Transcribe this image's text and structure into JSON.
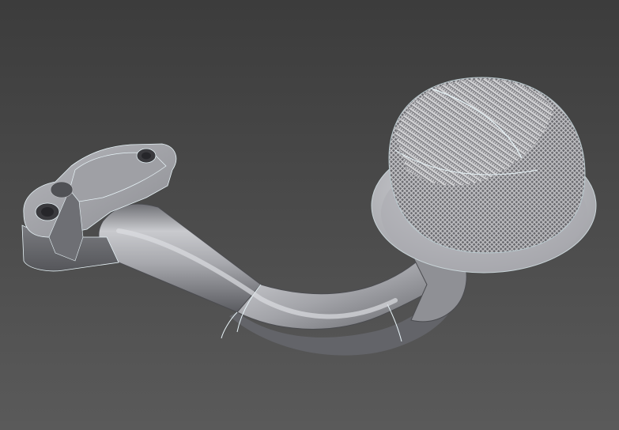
{
  "viewport": {
    "background_top": "#3c3c3c",
    "background_bottom": "#5a5a5a"
  },
  "model": {
    "part_colors": {
      "metal_light": "#c9cace",
      "metal_mid": "#9a9ba0",
      "metal_dark": "#5f6064",
      "edge_highlight": "#e8f4f8",
      "mesh": "#d8d8d8"
    },
    "components": [
      "flange",
      "pickup-tube",
      "screen-disc",
      "mesh-strainer"
    ]
  }
}
